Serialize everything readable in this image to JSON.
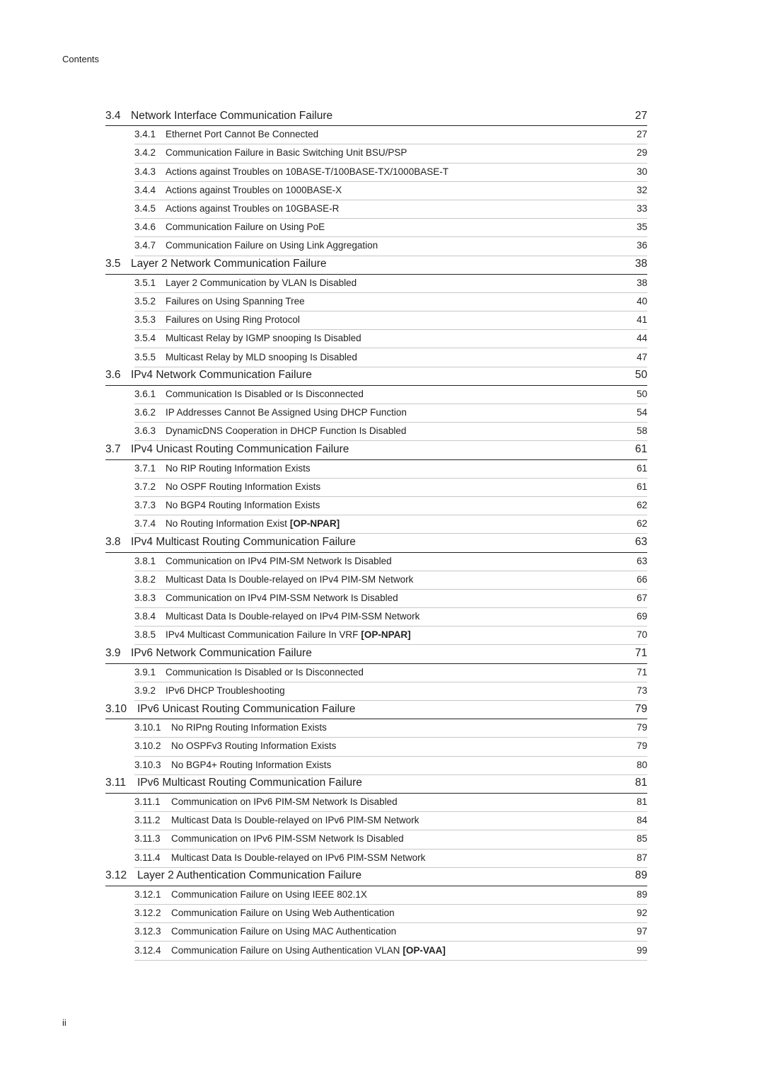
{
  "header": {
    "running_head": "Contents"
  },
  "footer": {
    "page_number": "ii"
  },
  "toc": [
    {
      "num": "3.4",
      "title": "Network Interface Communication Failure",
      "page": "27",
      "items": [
        {
          "num": "3.4.1",
          "title": "Ethernet Port Cannot Be Connected",
          "page": "27"
        },
        {
          "num": "3.4.2",
          "title": "Communication Failure in Basic Switching Unit BSU/PSP",
          "page": "29"
        },
        {
          "num": "3.4.3",
          "title": "Actions against Troubles on 10BASE-T/100BASE-TX/1000BASE-T",
          "page": "30"
        },
        {
          "num": "3.4.4",
          "title": "Actions against Troubles on 1000BASE-X",
          "page": "32"
        },
        {
          "num": "3.4.5",
          "title": "Actions against Troubles on 10GBASE-R",
          "page": "33"
        },
        {
          "num": "3.4.6",
          "title": "Communication Failure on Using PoE",
          "page": "35"
        },
        {
          "num": "3.4.7",
          "title": "Communication Failure on Using Link Aggregation",
          "page": "36"
        }
      ]
    },
    {
      "num": "3.5",
      "title": "Layer 2 Network Communication Failure",
      "page": "38",
      "items": [
        {
          "num": "3.5.1",
          "title": "Layer 2 Communication by VLAN Is Disabled",
          "page": "38"
        },
        {
          "num": "3.5.2",
          "title": "Failures on Using Spanning Tree",
          "page": "40"
        },
        {
          "num": "3.5.3",
          "title": "Failures on Using Ring Protocol",
          "page": "41"
        },
        {
          "num": "3.5.4",
          "title": "Multicast Relay by IGMP snooping Is Disabled",
          "page": "44"
        },
        {
          "num": "3.5.5",
          "title": "Multicast Relay by MLD snooping Is Disabled",
          "page": "47"
        }
      ]
    },
    {
      "num": "3.6",
      "title": "IPv4 Network Communication Failure",
      "page": "50",
      "items": [
        {
          "num": "3.6.1",
          "title": "Communication Is Disabled or Is Disconnected",
          "page": "50"
        },
        {
          "num": "3.6.2",
          "title": "IP Addresses Cannot Be Assigned Using DHCP Function",
          "page": "54"
        },
        {
          "num": "3.6.3",
          "title": "DynamicDNS Cooperation in DHCP Function Is Disabled",
          "page": "58"
        }
      ]
    },
    {
      "num": "3.7",
      "title": "IPv4 Unicast Routing Communication Failure",
      "page": "61",
      "items": [
        {
          "num": "3.7.1",
          "title": "No RIP Routing Information Exists",
          "page": "61"
        },
        {
          "num": "3.7.2",
          "title": "No OSPF Routing Information Exists",
          "page": "61"
        },
        {
          "num": "3.7.3",
          "title": "No BGP4 Routing Information Exists",
          "page": "62"
        },
        {
          "num": "3.7.4",
          "title": "No Routing Information Exist",
          "tag": "[OP-NPAR]",
          "page": "62"
        }
      ]
    },
    {
      "num": "3.8",
      "title": "IPv4 Multicast Routing Communication Failure",
      "page": "63",
      "items": [
        {
          "num": "3.8.1",
          "title": "Communication on IPv4 PIM-SM Network Is Disabled",
          "page": "63"
        },
        {
          "num": "3.8.2",
          "title": "Multicast Data Is Double-relayed on IPv4 PIM-SM Network",
          "page": "66"
        },
        {
          "num": "3.8.3",
          "title": "Communication on IPv4 PIM-SSM Network Is Disabled",
          "page": "67"
        },
        {
          "num": "3.8.4",
          "title": "Multicast Data Is Double-relayed on IPv4 PIM-SSM Network",
          "page": "69"
        },
        {
          "num": "3.8.5",
          "title": "IPv4 Multicast Communication Failure In VRF",
          "tag": "[OP-NPAR]",
          "page": "70"
        }
      ]
    },
    {
      "num": "3.9",
      "title": "IPv6 Network Communication Failure",
      "page": "71",
      "items": [
        {
          "num": "3.9.1",
          "title": "Communication Is Disabled or Is Disconnected",
          "page": "71"
        },
        {
          "num": "3.9.2",
          "title": "IPv6 DHCP Troubleshooting",
          "page": "73"
        }
      ]
    },
    {
      "num": "3.10",
      "title": "IPv6 Unicast Routing Communication Failure",
      "page": "79",
      "items": [
        {
          "num": "3.10.1",
          "title": "No RIPng Routing Information Exists",
          "page": "79"
        },
        {
          "num": "3.10.2",
          "title": "No OSPFv3 Routing Information Exists",
          "page": "79"
        },
        {
          "num": "3.10.3",
          "title": "No BGP4+ Routing Information Exists",
          "page": "80"
        }
      ]
    },
    {
      "num": "3.11",
      "title": "IPv6 Multicast Routing Communication Failure",
      "page": "81",
      "items": [
        {
          "num": "3.11.1",
          "title": "Communication on IPv6 PIM-SM Network Is Disabled",
          "page": "81"
        },
        {
          "num": "3.11.2",
          "title": "Multicast Data Is Double-relayed on IPv6 PIM-SM Network",
          "page": "84"
        },
        {
          "num": "3.11.3",
          "title": "Communication on IPv6 PIM-SSM Network Is Disabled",
          "page": "85"
        },
        {
          "num": "3.11.4",
          "title": "Multicast Data Is Double-relayed on IPv6 PIM-SSM Network",
          "page": "87"
        }
      ]
    },
    {
      "num": "3.12",
      "title": "Layer 2 Authentication Communication Failure",
      "page": "89",
      "items": [
        {
          "num": "3.12.1",
          "title": "Communication Failure on Using IEEE 802.1X",
          "page": "89"
        },
        {
          "num": "3.12.2",
          "title": "Communication Failure on Using Web Authentication",
          "page": "92"
        },
        {
          "num": "3.12.3",
          "title": "Communication Failure on Using MAC Authentication",
          "page": "97"
        },
        {
          "num": "3.12.4",
          "title": "Communication Failure on Using Authentication VLAN",
          "tag": "[OP-VAA]",
          "page": "99"
        }
      ]
    }
  ]
}
